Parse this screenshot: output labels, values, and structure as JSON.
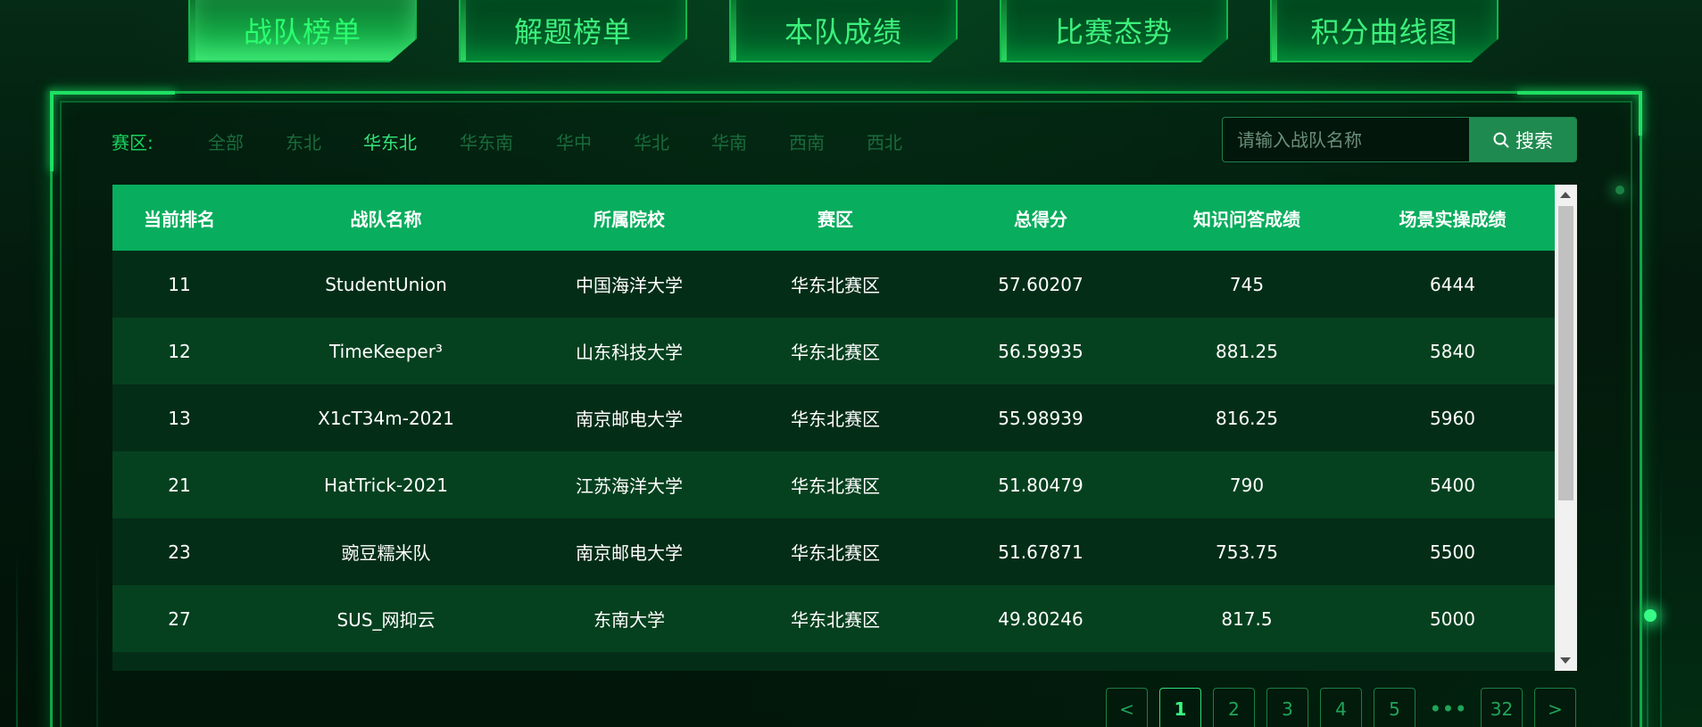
{
  "tabs": [
    {
      "label": "战队榜单",
      "active": true
    },
    {
      "label": "解题榜单",
      "active": false
    },
    {
      "label": "本队成绩",
      "active": false
    },
    {
      "label": "比赛态势",
      "active": false
    },
    {
      "label": "积分曲线图",
      "active": false
    }
  ],
  "filter": {
    "label": "赛区:",
    "options": [
      "全部",
      "东北",
      "华东北",
      "华东南",
      "华中",
      "华北",
      "华南",
      "西南",
      "西北"
    ],
    "selected": "华东北"
  },
  "search": {
    "placeholder": "请输入战队名称",
    "value": "",
    "button_label": "搜索",
    "icon": "search-icon"
  },
  "table": {
    "headers": [
      "当前排名",
      "战队名称",
      "所属院校",
      "赛区",
      "总得分",
      "知识问答成绩",
      "场景实操成绩"
    ],
    "rows": [
      [
        "11",
        "StudentUnion",
        "中国海洋大学",
        "华东北赛区",
        "57.60207",
        "745",
        "6444"
      ],
      [
        "12",
        "TimeKeeper³",
        "山东科技大学",
        "华东北赛区",
        "56.59935",
        "881.25",
        "5840"
      ],
      [
        "13",
        "X1cT34m-2021",
        "南京邮电大学",
        "华东北赛区",
        "55.98939",
        "816.25",
        "5960"
      ],
      [
        "21",
        "HatTrick-2021",
        "江苏海洋大学",
        "华东北赛区",
        "51.80479",
        "790",
        "5400"
      ],
      [
        "23",
        "豌豆糯米队",
        "南京邮电大学",
        "华东北赛区",
        "51.67871",
        "753.75",
        "5500"
      ],
      [
        "27",
        "SUS_网抑云",
        "东南大学",
        "华东北赛区",
        "49.80246",
        "817.5",
        "5000"
      ]
    ]
  },
  "pagination": {
    "prev": "<",
    "next": ">",
    "pages": [
      "1",
      "2",
      "3",
      "4",
      "5"
    ],
    "ellipsis": "•••",
    "last": "32",
    "current": "1"
  },
  "colors": {
    "accent": "#08ad5d",
    "tab_text": "#3df07c",
    "background": "#03150b"
  }
}
